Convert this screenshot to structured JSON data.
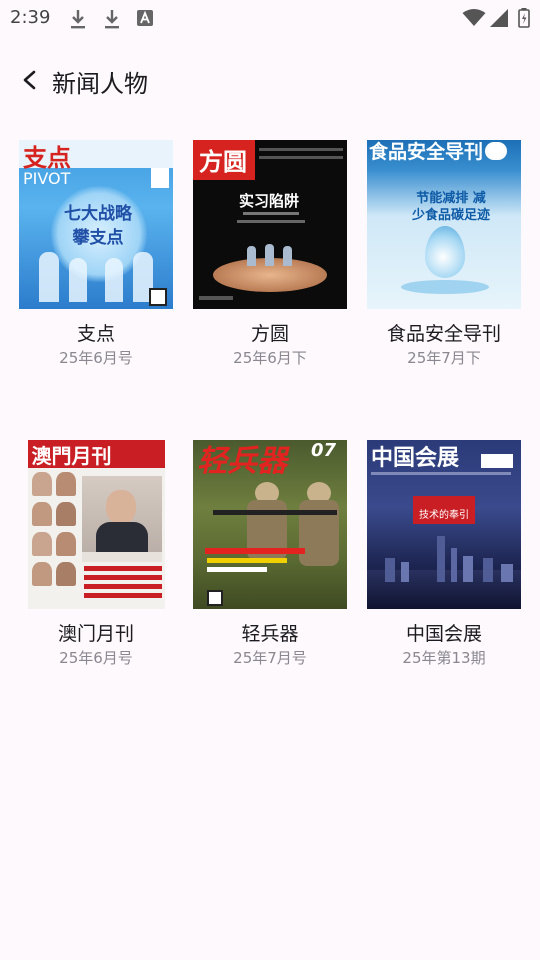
{
  "status_bar": {
    "time": "2:39"
  },
  "header": {
    "title": "新闻人物"
  },
  "magazines": [
    {
      "title": "支点",
      "issue": "25年6月号",
      "cover_mast": "支点",
      "cover_sub": "PIVOT",
      "cover_text": "七大战略 攀支点"
    },
    {
      "title": "方圆",
      "issue": "25年6月下",
      "cover_mast": "方圆",
      "cover_text": "实习陷阱"
    },
    {
      "title": "食品安全导刊",
      "issue": "25年7月下",
      "cover_mast": "食品安全导刊",
      "cover_text": "节能减排 减少食品碳足迹"
    },
    {
      "title": "澳门月刊",
      "issue": "25年6月号",
      "cover_mast": "澳門月刊"
    },
    {
      "title": "轻兵器",
      "issue": "25年7月号",
      "cover_mast": "轻兵器",
      "cover_num": "07"
    },
    {
      "title": "中国会展",
      "issue": "25年第13期",
      "cover_mast": "中国会展",
      "cover_text": "技术的奉引"
    }
  ]
}
